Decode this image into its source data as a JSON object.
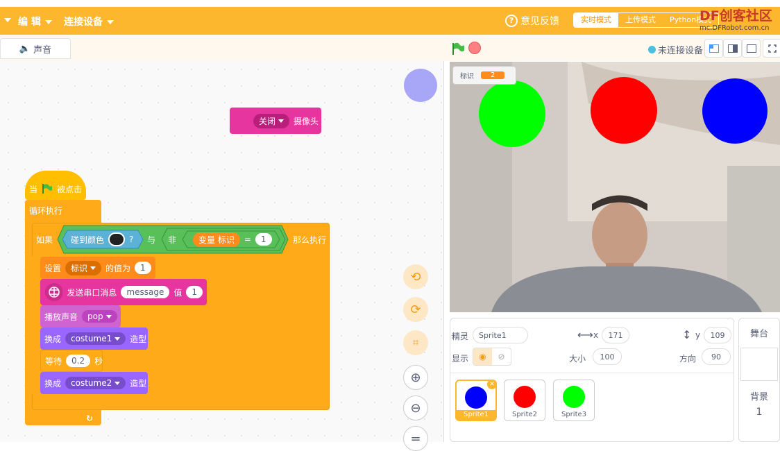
{
  "menu": {
    "edit": "编 辑",
    "connect": "连接设备"
  },
  "header": {
    "feedback": "意见反馈",
    "modes": [
      "实时模式",
      "上传模式",
      "Python模式"
    ],
    "watermark_title": "DF创客社区",
    "watermark_url": "mc.DFRobot.com.cn"
  },
  "tabs": {
    "sound": "声音"
  },
  "stage_controls": {
    "connection": "未连接设备"
  },
  "blocks": {
    "close_camera": {
      "option": "关闭",
      "label": "摄像头"
    },
    "when_flag": {
      "prefix": "当",
      "suffix": "被点击"
    },
    "forever": "循环执行",
    "if": {
      "label": "如果",
      "touch_color": "碰到颜色",
      "question": "?",
      "and": "与",
      "not": "非",
      "variable": "变量 标识",
      "eq": "=",
      "value": "1",
      "then": "那么执行"
    },
    "set": {
      "label": "设置",
      "var": "标识",
      "to": "的值为",
      "value": "1"
    },
    "serial": {
      "label": "发送串口消息",
      "msg": "message",
      "val_label": "值",
      "val": "1"
    },
    "play": {
      "label": "播放声音",
      "sound": "pop"
    },
    "switch1": {
      "label": "换成",
      "costume": "costume1",
      "suffix": "造型"
    },
    "wait": {
      "label": "等待",
      "value": "0.2",
      "unit": "秒"
    },
    "switch2": {
      "label": "换成",
      "costume": "costume2",
      "suffix": "造型"
    }
  },
  "monitor": {
    "label": "标识",
    "value": "2"
  },
  "sprite_info": {
    "sprite_label": "精灵",
    "sprite_name": "Sprite1",
    "x_label": "x",
    "x": "171",
    "y_label": "y",
    "y": "109",
    "show_label": "显示",
    "size_label": "大小",
    "size": "100",
    "dir_label": "方向",
    "direction": "90"
  },
  "sprites": [
    {
      "name": "Sprite1",
      "color": "#0000ff"
    },
    {
      "name": "Sprite2",
      "color": "#ff0000"
    },
    {
      "name": "Sprite3",
      "color": "#00ff00"
    }
  ],
  "stage_panel": {
    "title": "舞台",
    "backdrop_label": "背景",
    "backdrop_count": "1"
  },
  "colors": {
    "orange": "#fdb72e",
    "control": "#ffab19",
    "events": "#ffbf00",
    "operators": "#59c059",
    "sensing": "#5cb1d6",
    "variables": "#ff8c1a",
    "looks": "#9966ff",
    "sound": "#cf63cf",
    "extension": "#e6359e"
  }
}
